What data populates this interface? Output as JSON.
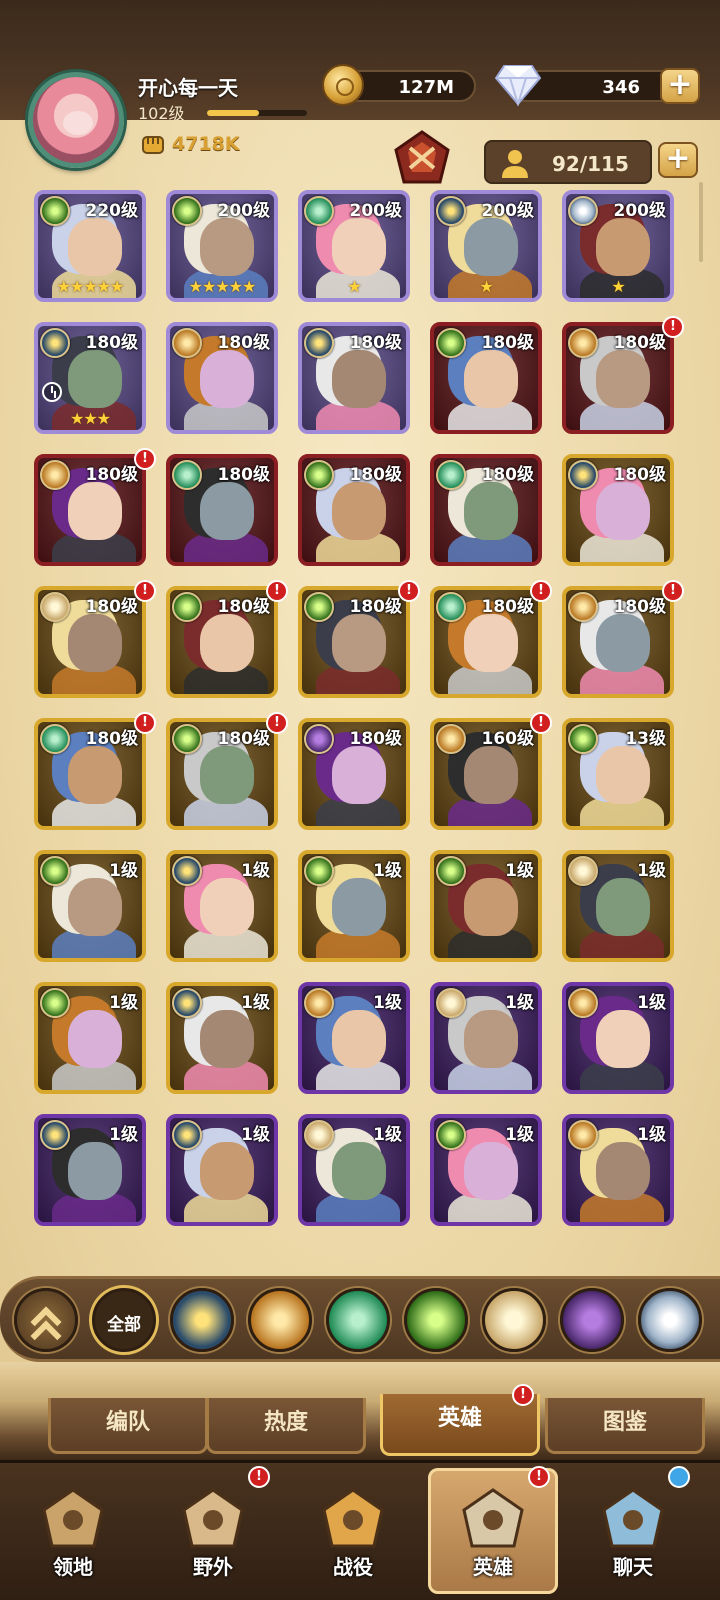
{
  "player": {
    "name": "开心每一天",
    "level": "102级",
    "power": "4718K",
    "xp_progress": 0.52
  },
  "resources": {
    "gold": "127M",
    "diamonds": "346",
    "plus_label": "+"
  },
  "capacity": "92/115",
  "heroes": [
    {
      "level": "220级",
      "rarity": "purple",
      "faction": "wild",
      "stars": "★★★★★",
      "alert": false
    },
    {
      "level": "200级",
      "rarity": "purple",
      "faction": "wild",
      "stars": "★★★★★",
      "alert": false
    },
    {
      "level": "200级",
      "rarity": "purple",
      "faction": "nature",
      "stars": "★",
      "alert": false
    },
    {
      "level": "200级",
      "rarity": "purple",
      "faction": "star",
      "stars": "★",
      "alert": false
    },
    {
      "level": "200级",
      "rarity": "purple",
      "faction": "celestial",
      "stars": "★",
      "alert": false
    },
    {
      "level": "180级",
      "rarity": "purple",
      "faction": "star",
      "stars": "★★★",
      "alert": false,
      "clock": true
    },
    {
      "level": "180级",
      "rarity": "purple",
      "faction": "order",
      "stars": "",
      "alert": false
    },
    {
      "level": "180级",
      "rarity": "purple",
      "faction": "star",
      "stars": "",
      "alert": false
    },
    {
      "level": "180级",
      "rarity": "red",
      "faction": "wild",
      "stars": "",
      "alert": false
    },
    {
      "level": "180级",
      "rarity": "red",
      "faction": "order",
      "stars": "",
      "alert": true
    },
    {
      "level": "180级",
      "rarity": "red",
      "faction": "order",
      "stars": "",
      "alert": true
    },
    {
      "level": "180级",
      "rarity": "red",
      "faction": "nature",
      "stars": "",
      "alert": false
    },
    {
      "level": "180级",
      "rarity": "red",
      "faction": "wild",
      "stars": "",
      "alert": false
    },
    {
      "level": "180级",
      "rarity": "red",
      "faction": "nature",
      "stars": "",
      "alert": false
    },
    {
      "level": "180级",
      "rarity": "gold",
      "faction": "star",
      "stars": "",
      "alert": false
    },
    {
      "level": "180级",
      "rarity": "gold",
      "faction": "light",
      "stars": "",
      "alert": true
    },
    {
      "level": "180级",
      "rarity": "gold",
      "faction": "wild",
      "stars": "",
      "alert": true
    },
    {
      "level": "180级",
      "rarity": "gold",
      "faction": "wild",
      "stars": "",
      "alert": true
    },
    {
      "level": "180级",
      "rarity": "gold",
      "faction": "nature",
      "stars": "",
      "alert": true
    },
    {
      "level": "180级",
      "rarity": "gold",
      "faction": "order",
      "stars": "",
      "alert": true
    },
    {
      "level": "180级",
      "rarity": "gold",
      "faction": "nature",
      "stars": "",
      "alert": true
    },
    {
      "level": "180级",
      "rarity": "gold",
      "faction": "wild",
      "stars": "",
      "alert": true
    },
    {
      "level": "180级",
      "rarity": "gold",
      "faction": "dark",
      "stars": "",
      "alert": false
    },
    {
      "level": "160级",
      "rarity": "gold",
      "faction": "order",
      "stars": "",
      "alert": true
    },
    {
      "level": "13级",
      "rarity": "gold",
      "faction": "wild",
      "stars": "",
      "alert": false
    },
    {
      "level": "1级",
      "rarity": "gold",
      "faction": "wild",
      "stars": "",
      "alert": false
    },
    {
      "level": "1级",
      "rarity": "gold",
      "faction": "star",
      "stars": "",
      "alert": false
    },
    {
      "level": "1级",
      "rarity": "gold",
      "faction": "wild",
      "stars": "",
      "alert": false
    },
    {
      "level": "1级",
      "rarity": "gold",
      "faction": "wild",
      "stars": "",
      "alert": false
    },
    {
      "level": "1级",
      "rarity": "gold",
      "faction": "light",
      "stars": "",
      "alert": false
    },
    {
      "level": "1级",
      "rarity": "gold",
      "faction": "wild",
      "stars": "",
      "alert": false
    },
    {
      "level": "1级",
      "rarity": "gold",
      "faction": "star",
      "stars": "",
      "alert": false
    },
    {
      "level": "1级",
      "rarity": "violet",
      "faction": "order",
      "stars": "",
      "alert": false
    },
    {
      "level": "1级",
      "rarity": "violet",
      "faction": "light",
      "stars": "",
      "alert": false
    },
    {
      "level": "1级",
      "rarity": "violet",
      "faction": "order",
      "stars": "",
      "alert": false
    },
    {
      "level": "1级",
      "rarity": "violet",
      "faction": "star",
      "stars": "",
      "alert": false
    },
    {
      "level": "1级",
      "rarity": "violet",
      "faction": "star",
      "stars": "",
      "alert": false
    },
    {
      "level": "1级",
      "rarity": "violet",
      "faction": "light",
      "stars": "",
      "alert": false
    },
    {
      "level": "1级",
      "rarity": "violet",
      "faction": "wild",
      "stars": "",
      "alert": false
    },
    {
      "level": "1级",
      "rarity": "violet",
      "faction": "order",
      "stars": "",
      "alert": false
    }
  ],
  "filters": {
    "all_label": "全部",
    "factions": [
      "star",
      "order",
      "nature",
      "wild",
      "light",
      "dark",
      "celestial"
    ]
  },
  "tabs": [
    {
      "label": "编队",
      "active": false,
      "alert": false
    },
    {
      "label": "热度",
      "active": false,
      "alert": false
    },
    {
      "label": "英雄",
      "active": true,
      "alert": true
    },
    {
      "label": "图鉴",
      "active": false,
      "alert": false
    }
  ],
  "nav": [
    {
      "label": "领地",
      "icon": "castle-icon",
      "active": false,
      "badge": "none"
    },
    {
      "label": "野外",
      "icon": "map-scroll-icon",
      "active": false,
      "badge": "alert"
    },
    {
      "label": "战役",
      "icon": "battle-crest-icon",
      "active": false,
      "badge": "none"
    },
    {
      "label": "英雄",
      "icon": "helmet-icon",
      "active": true,
      "badge": "alert"
    },
    {
      "label": "聊天",
      "icon": "chat-bubble-icon",
      "active": false,
      "badge": "dot"
    }
  ]
}
